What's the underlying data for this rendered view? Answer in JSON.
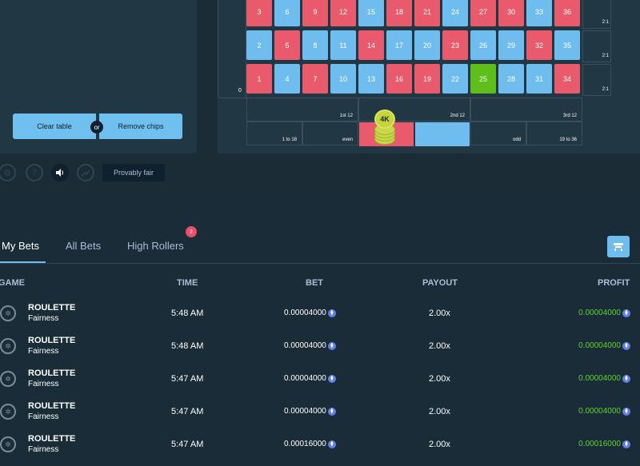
{
  "controls": {
    "clear_label": "Clear table",
    "or_label": "or",
    "remove_label": "Remove chips",
    "provably_fair_label": "Provably fair"
  },
  "board": {
    "zero_label": "0",
    "column_label": "2:1",
    "dozens": [
      "1st 12",
      "2nd 12",
      "3rd 12"
    ],
    "outside": [
      "1 to 18",
      "even",
      "",
      "",
      "odd",
      "19 to 36"
    ],
    "chip_label": "4K",
    "rows": [
      [
        {
          "n": "3",
          "c": "red"
        },
        {
          "n": "6",
          "c": "blue"
        },
        {
          "n": "9",
          "c": "red"
        },
        {
          "n": "12",
          "c": "red"
        },
        {
          "n": "15",
          "c": "blue"
        },
        {
          "n": "18",
          "c": "red"
        },
        {
          "n": "21",
          "c": "red"
        },
        {
          "n": "24",
          "c": "blue"
        },
        {
          "n": "27",
          "c": "red"
        },
        {
          "n": "30",
          "c": "red"
        },
        {
          "n": "33",
          "c": "blue"
        },
        {
          "n": "36",
          "c": "red"
        }
      ],
      [
        {
          "n": "2",
          "c": "blue"
        },
        {
          "n": "5",
          "c": "red"
        },
        {
          "n": "8",
          "c": "blue"
        },
        {
          "n": "11",
          "c": "blue"
        },
        {
          "n": "14",
          "c": "red"
        },
        {
          "n": "17",
          "c": "blue"
        },
        {
          "n": "20",
          "c": "blue"
        },
        {
          "n": "23",
          "c": "red"
        },
        {
          "n": "26",
          "c": "blue"
        },
        {
          "n": "29",
          "c": "blue"
        },
        {
          "n": "32",
          "c": "red"
        },
        {
          "n": "35",
          "c": "blue"
        }
      ],
      [
        {
          "n": "1",
          "c": "red"
        },
        {
          "n": "4",
          "c": "blue"
        },
        {
          "n": "7",
          "c": "red"
        },
        {
          "n": "10",
          "c": "blue"
        },
        {
          "n": "13",
          "c": "blue"
        },
        {
          "n": "16",
          "c": "red"
        },
        {
          "n": "19",
          "c": "red"
        },
        {
          "n": "22",
          "c": "blue"
        },
        {
          "n": "25",
          "c": "green"
        },
        {
          "n": "28",
          "c": "blue"
        },
        {
          "n": "31",
          "c": "blue"
        },
        {
          "n": "34",
          "c": "red"
        }
      ]
    ]
  },
  "tabs": {
    "my_bets": "My Bets",
    "all_bets": "All Bets",
    "high_rollers": "High Rollers",
    "badge_count": "2"
  },
  "table": {
    "headers": {
      "game": "GAME",
      "time": "TIME",
      "bet": "BET",
      "payout": "PAYOUT",
      "profit": "PROFIT"
    },
    "rows": [
      {
        "game": "ROULETTE",
        "sub": "Fairness",
        "time": "5:48 AM",
        "bet": "0.00004000",
        "payout": "2.00x",
        "profit": "0.00004000"
      },
      {
        "game": "ROULETTE",
        "sub": "Fairness",
        "time": "5:48 AM",
        "bet": "0.00004000",
        "payout": "2.00x",
        "profit": "0.00004000"
      },
      {
        "game": "ROULETTE",
        "sub": "Fairness",
        "time": "5:47 AM",
        "bet": "0.00004000",
        "payout": "2.00x",
        "profit": "0.00004000"
      },
      {
        "game": "ROULETTE",
        "sub": "Fairness",
        "time": "5:47 AM",
        "bet": "0.00004000",
        "payout": "2.00x",
        "profit": "0.00004000"
      },
      {
        "game": "ROULETTE",
        "sub": "Fairness",
        "time": "5:47 AM",
        "bet": "0.00016000",
        "payout": "2.00x",
        "profit": "0.00016000"
      }
    ]
  },
  "colors": {
    "red": "#e85a6c",
    "blue": "#6fbdee",
    "green": "#5fbf1a",
    "profit": "#5fd32c"
  }
}
